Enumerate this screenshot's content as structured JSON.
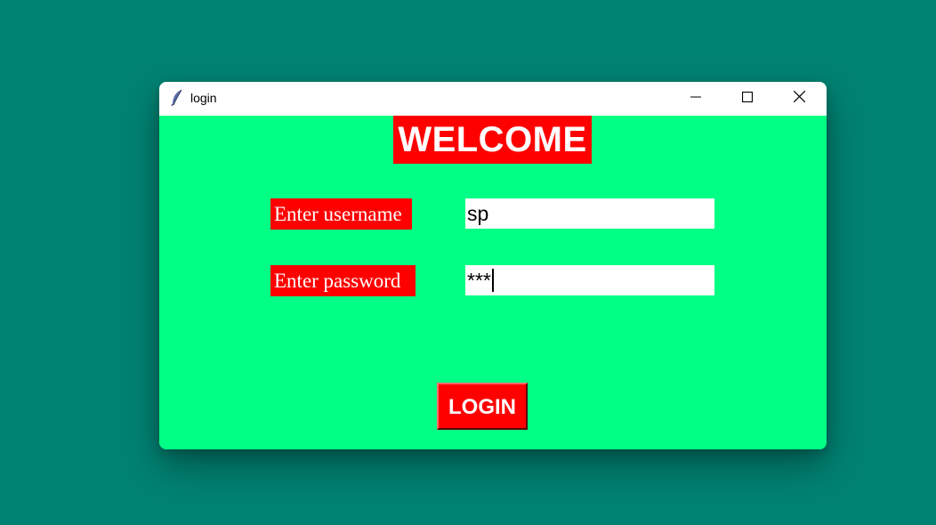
{
  "window": {
    "title": "login",
    "app_icon": "feather-icon",
    "controls": {
      "minimize": "minimize-icon",
      "maximize": "maximize-icon",
      "close": "close-icon"
    }
  },
  "form": {
    "heading": "WELCOME",
    "username_label": "Enter username",
    "username_value": "sp",
    "password_label": "Enter password",
    "password_value": "***",
    "login_label": "LOGIN"
  },
  "colors": {
    "desktop_bg": "#008272",
    "window_bg": "#00ff84",
    "accent_red": "#ff0000",
    "text_white": "#ffffff"
  }
}
